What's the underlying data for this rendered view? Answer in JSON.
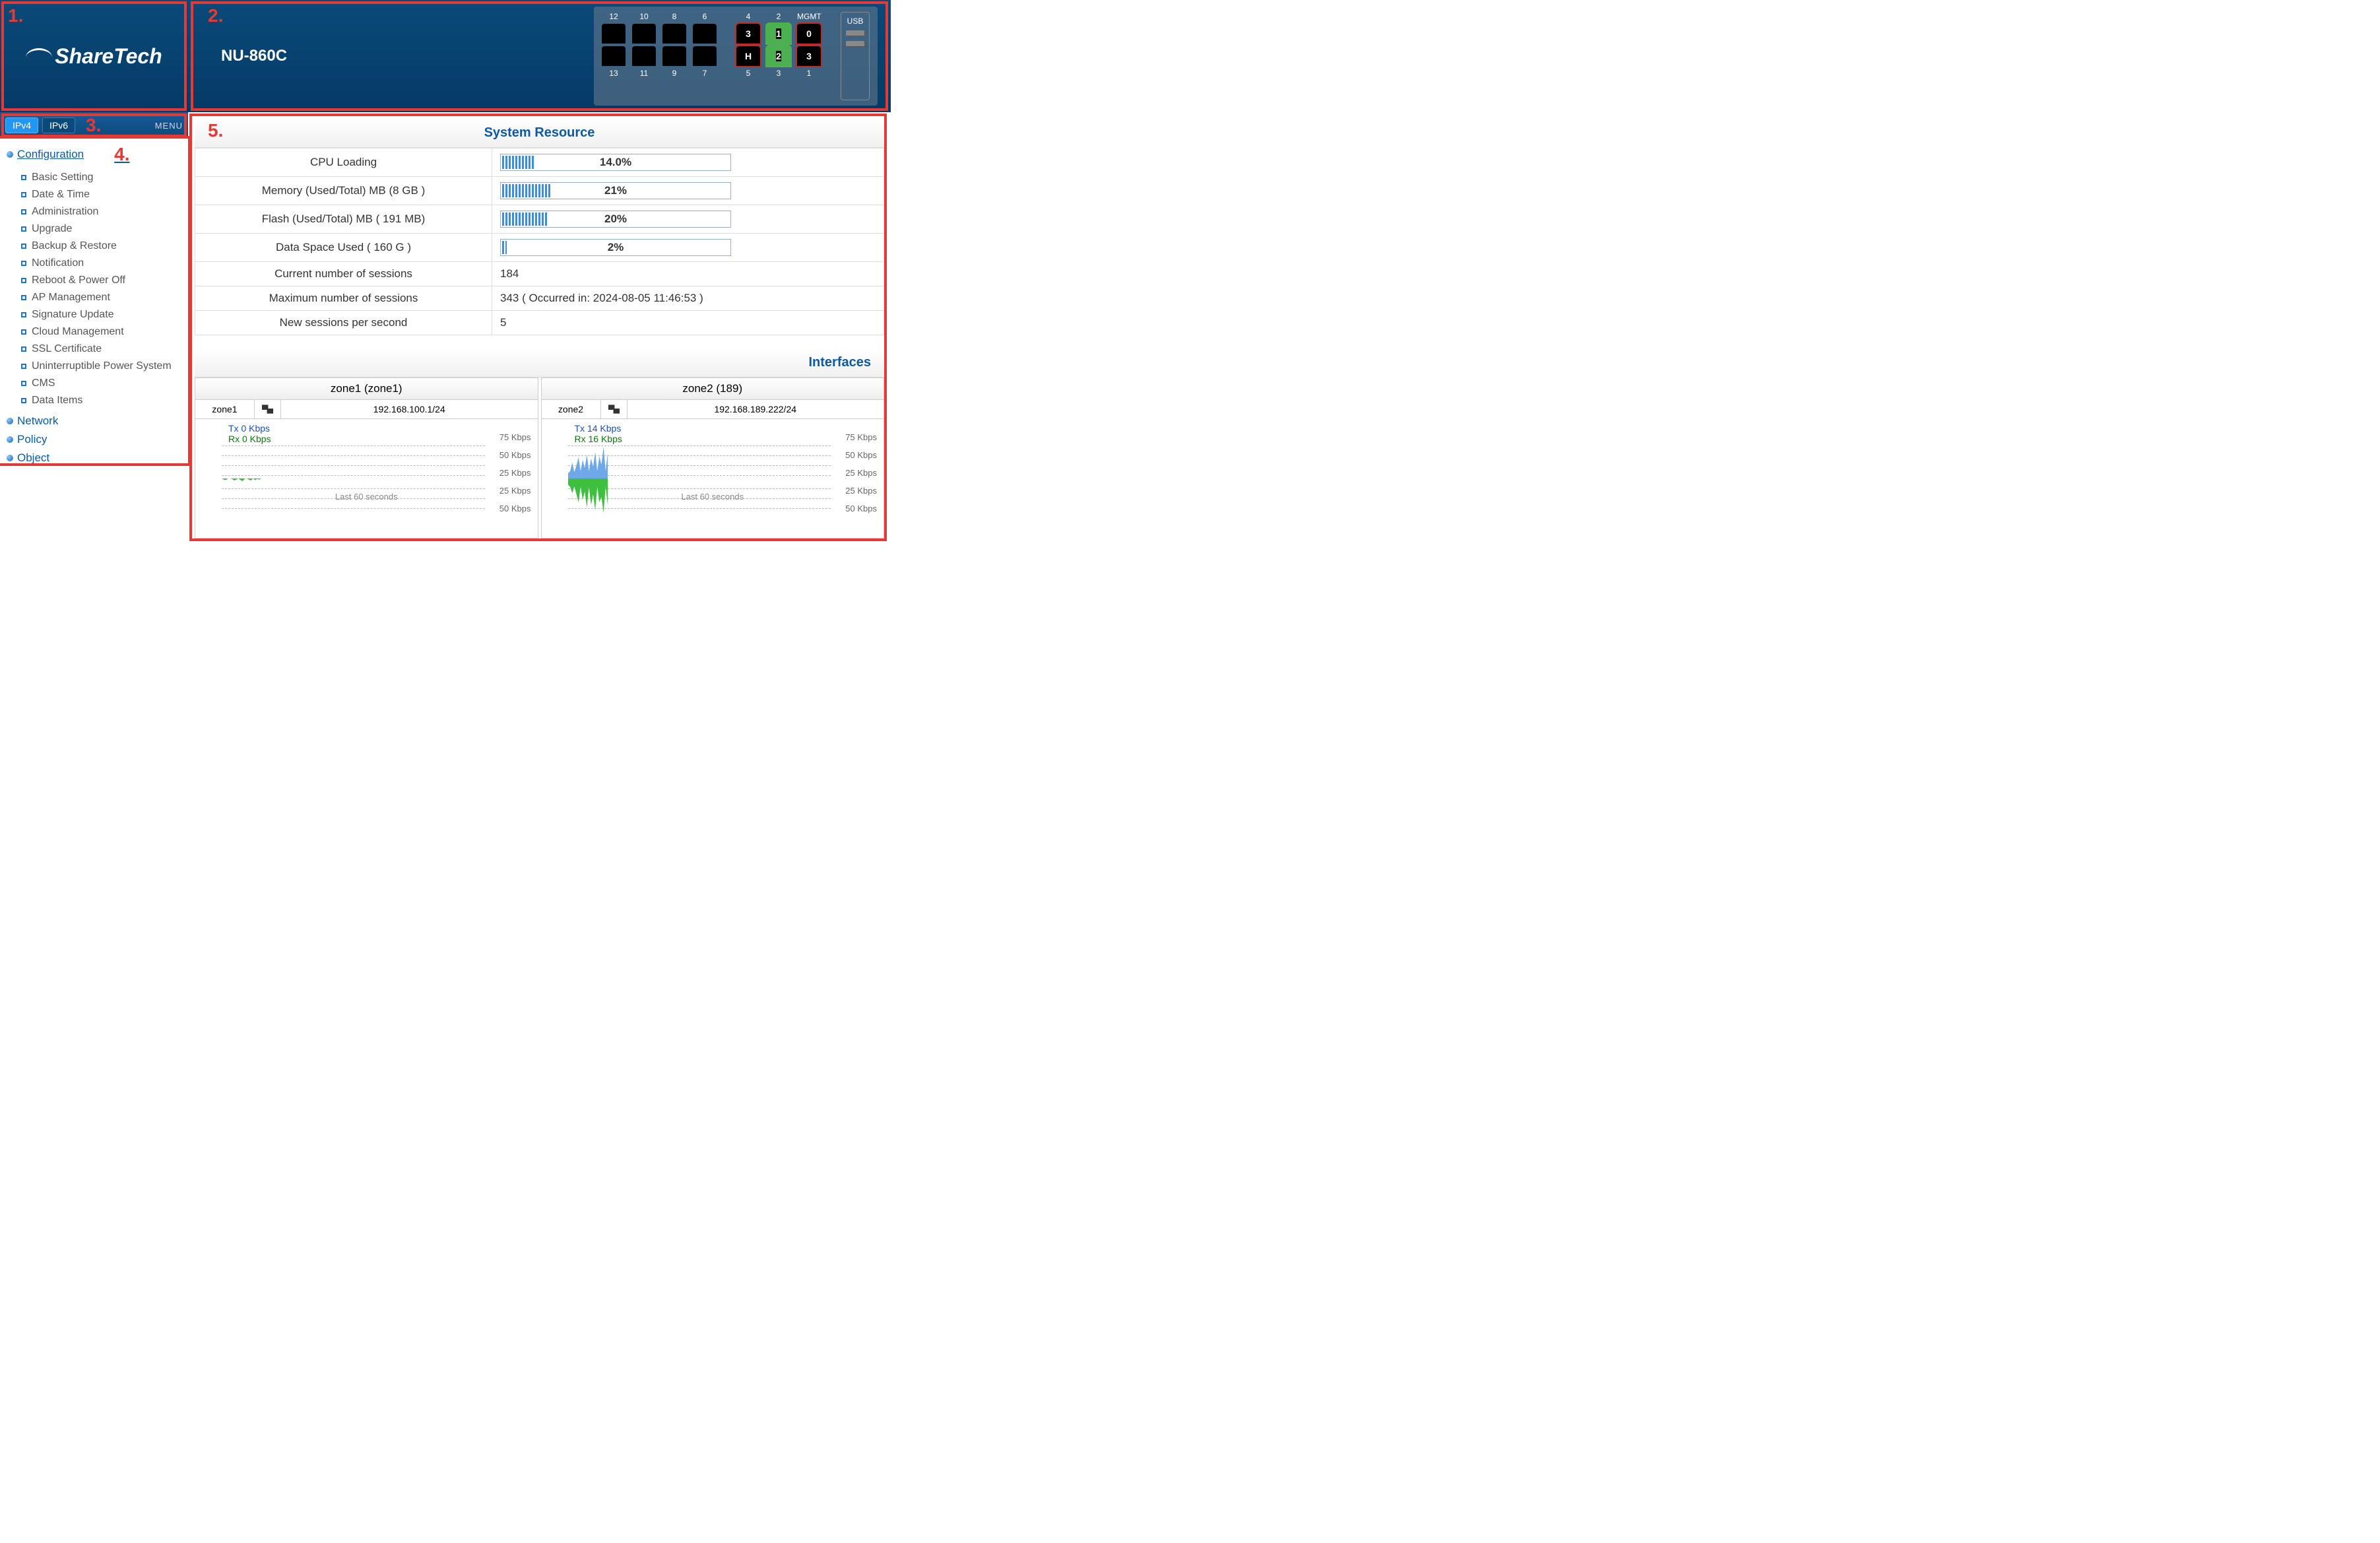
{
  "header": {
    "brand": "ShareTech",
    "model": "NU-860C",
    "ports_top_labels": [
      "12",
      "10",
      "8",
      "6"
    ],
    "ports_bottom_labels": [
      "13",
      "11",
      "9",
      "7"
    ],
    "ports_right_top_labels": [
      "4",
      "2",
      "MGMT"
    ],
    "ports_right_top_values": [
      "3",
      "1",
      "0"
    ],
    "ports_right_bottom_labels": [
      "5",
      "3",
      "1"
    ],
    "ports_right_bottom_values": [
      "H",
      "2",
      "3"
    ],
    "usb_label": "USB"
  },
  "annotations": {
    "n1": "1.",
    "n2": "2.",
    "n3": "3.",
    "n4": "4.",
    "n5": "5."
  },
  "ipbar": {
    "v4": "IPv4",
    "v6": "IPv6",
    "menu": "MENU"
  },
  "nav": {
    "config_head": "Configuration",
    "config_items": [
      "Basic Setting",
      "Date & Time",
      "Administration",
      "Upgrade",
      "Backup & Restore",
      "Notification",
      "Reboot & Power Off",
      "AP Management",
      "Signature Update",
      "Cloud Management",
      "SSL Certificate",
      "Uninterruptible Power System",
      "CMS",
      "Data Items"
    ],
    "sections": [
      "Network",
      "Policy",
      "Object"
    ]
  },
  "resource": {
    "title": "System Resource",
    "rows": [
      {
        "label": "CPU Loading",
        "pct": 14.0,
        "display": "14.0%"
      },
      {
        "label": "Memory (Used/Total) MB (8 GB )",
        "pct": 21,
        "display": "21%"
      },
      {
        "label": "Flash (Used/Total) MB ( 191 MB)",
        "pct": 20,
        "display": "20%"
      },
      {
        "label": "Data Space Used ( 160 G )",
        "pct": 2,
        "display": "2%"
      }
    ],
    "sessions_cur_label": "Current number of sessions",
    "sessions_cur": "184",
    "sessions_max_label": "Maximum number of sessions",
    "sessions_max": "343 ( Occurred in: 2024-08-05 11:46:53 )",
    "sessions_new_label": "New sessions per second",
    "sessions_new": "5"
  },
  "interfaces": {
    "title": "Interfaces",
    "cards": [
      {
        "title": "zone1 (zone1)",
        "name": "zone1",
        "ip": "192.168.100.1/24",
        "tx": "Tx 0 Kbps",
        "rx": "Rx 0 Kbps"
      },
      {
        "title": "zone2 (189)",
        "name": "zone2",
        "ip": "192.168.189.222/24",
        "tx": "Tx 14 Kbps",
        "rx": "Rx 16 Kbps"
      }
    ],
    "ylabels_up": [
      "75 Kbps",
      "50 Kbps",
      "25 Kbps"
    ],
    "ylabels_down": [
      "25 Kbps",
      "50 Kbps"
    ],
    "last60": "Last 60 seconds"
  },
  "chart_data": [
    {
      "type": "area",
      "title": "zone1 traffic (last 60s)",
      "xlabel": "seconds",
      "ylabel": "Kbps",
      "series": [
        {
          "name": "Tx",
          "values": [
            0,
            0,
            0,
            0,
            0,
            0,
            0,
            0,
            0,
            0,
            0,
            0,
            0,
            0,
            0,
            0,
            0,
            0,
            0,
            0
          ]
        },
        {
          "name": "Rx",
          "values": [
            0,
            2,
            3,
            0,
            0,
            1,
            4,
            2,
            0,
            3,
            5,
            1,
            0,
            2,
            4,
            0,
            3,
            1,
            2,
            0
          ]
        }
      ],
      "x": [
        -60,
        -57,
        -54,
        -51,
        -48,
        -45,
        -42,
        -39,
        -36,
        -33,
        -30,
        -27,
        -24,
        -21,
        -18,
        -15,
        -12,
        -9,
        -6,
        -3
      ],
      "ylim": [
        -75,
        75
      ]
    },
    {
      "type": "area",
      "title": "zone2 traffic (last 60s)",
      "xlabel": "seconds",
      "ylabel": "Kbps",
      "series": [
        {
          "name": "Tx",
          "values": [
            10,
            14,
            30,
            12,
            25,
            40,
            14,
            35,
            20,
            45,
            14,
            38,
            22,
            50,
            14,
            42,
            26,
            60,
            14,
            48
          ]
        },
        {
          "name": "Rx",
          "values": [
            12,
            16,
            28,
            15,
            30,
            45,
            16,
            40,
            25,
            55,
            16,
            50,
            30,
            60,
            16,
            45,
            35,
            65,
            16,
            50
          ]
        }
      ],
      "x": [
        -60,
        -57,
        -54,
        -51,
        -48,
        -45,
        -42,
        -39,
        -36,
        -33,
        -30,
        -27,
        -24,
        -21,
        -18,
        -15,
        -12,
        -9,
        -6,
        -3
      ],
      "ylim": [
        -75,
        75
      ]
    }
  ]
}
